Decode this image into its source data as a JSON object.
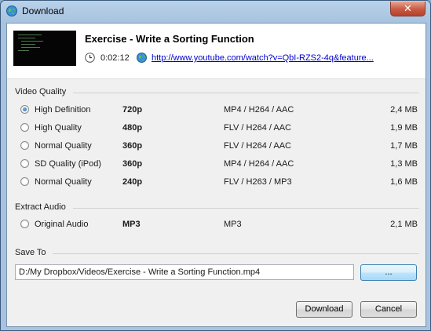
{
  "window": {
    "title": "Download"
  },
  "video": {
    "title": "Exercise - Write a Sorting Function",
    "duration": "0:02:12",
    "url": "http://www.youtube.com/watch?v=QbI-RZS2-4q&feature..."
  },
  "video_quality": {
    "label": "Video Quality",
    "options": [
      {
        "name": "High Definition",
        "resolution": "720p",
        "format": "MP4 / H264 / AAC",
        "size": "2,4 MB",
        "selected": true
      },
      {
        "name": "High Quality",
        "resolution": "480p",
        "format": "FLV / H264 / AAC",
        "size": "1,9 MB",
        "selected": false
      },
      {
        "name": "Normal Quality",
        "resolution": "360p",
        "format": "FLV / H264 / AAC",
        "size": "1,7 MB",
        "selected": false
      },
      {
        "name": "SD Quality (iPod)",
        "resolution": "360p",
        "format": "MP4 / H264 / AAC",
        "size": "1,3 MB",
        "selected": false
      },
      {
        "name": "Normal Quality",
        "resolution": "240p",
        "format": "FLV / H263 / MP3",
        "size": "1,6 MB",
        "selected": false
      }
    ]
  },
  "extract_audio": {
    "label": "Extract Audio",
    "options": [
      {
        "name": "Original Audio",
        "resolution": "MP3",
        "format": "MP3",
        "size": "2,1 MB",
        "selected": false
      }
    ]
  },
  "save_to": {
    "label": "Save To",
    "path": "D:/My Dropbox/Videos/Exercise - Write a Sorting Function.mp4",
    "browse_label": "..."
  },
  "buttons": {
    "download": "Download",
    "cancel": "Cancel"
  },
  "icons": {
    "app": "globe-icon",
    "close": "close-icon",
    "duration": "clock-icon",
    "link": "globe-icon"
  },
  "colors": {
    "link": "#0000cc",
    "titlebar": "#b9d1ea",
    "close": "#c75a43",
    "radio_selected": "#1c5ea6"
  }
}
